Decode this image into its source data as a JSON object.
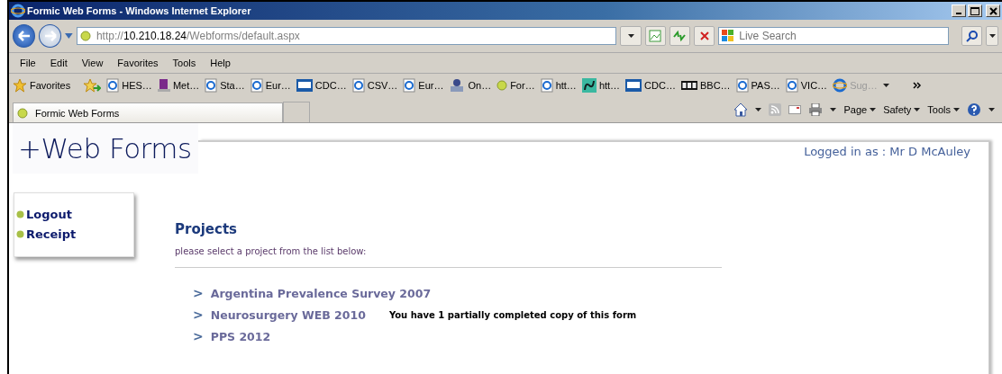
{
  "window": {
    "title": "Formic Web Forms - Windows Internet Explorer"
  },
  "address_bar": {
    "url_prefix": "http://",
    "url_host": "10.210.18.24",
    "url_path": "/Webforms/default.aspx"
  },
  "search": {
    "placeholder": "Live Search"
  },
  "menu": [
    "File",
    "Edit",
    "View",
    "Favorites",
    "Tools",
    "Help"
  ],
  "favorites_bar": {
    "label": "Favorites",
    "items": [
      {
        "label": "HES…",
        "kind": "ie"
      },
      {
        "label": "Met…",
        "kind": "purple"
      },
      {
        "label": "Sta…",
        "kind": "ie"
      },
      {
        "label": "Eur…",
        "kind": "ie"
      },
      {
        "label": "CDC…",
        "kind": "cdc"
      },
      {
        "label": "CSV…",
        "kind": "ie"
      },
      {
        "label": "Eur…",
        "kind": "ie"
      },
      {
        "label": "On…",
        "kind": "people"
      },
      {
        "label": "For…",
        "kind": "ball"
      },
      {
        "label": "htt…",
        "kind": "ie"
      },
      {
        "label": "htt…",
        "kind": "snake"
      },
      {
        "label": "CDC…",
        "kind": "cdc"
      },
      {
        "label": "BBC…",
        "kind": "bbc"
      },
      {
        "label": "PAS…",
        "kind": "ie"
      },
      {
        "label": "VIC…",
        "kind": "ie"
      },
      {
        "label": "Sug…",
        "kind": "iebig",
        "disabled": true
      }
    ]
  },
  "tabs": [
    {
      "label": "Formic Web Forms",
      "selected": true
    }
  ],
  "command_bar": [
    "Page",
    "Safety",
    "Tools"
  ],
  "page": {
    "logo": "+Web Forms",
    "logged_in": "Logged in as : Mr D McAuley",
    "sidebar": [
      "Logout",
      "Receipt"
    ],
    "heading": "Projects",
    "subtitle": "please select a project from the list below:",
    "projects": [
      {
        "marker": ">",
        "name": "Argentina Prevalence Survey 2007"
      },
      {
        "marker": ">",
        "name": "Neurosurgery WEB 2010",
        "note": "You have 1 partially completed copy of this form"
      },
      {
        "marker": ">",
        "name": "PPS 2012"
      }
    ]
  }
}
